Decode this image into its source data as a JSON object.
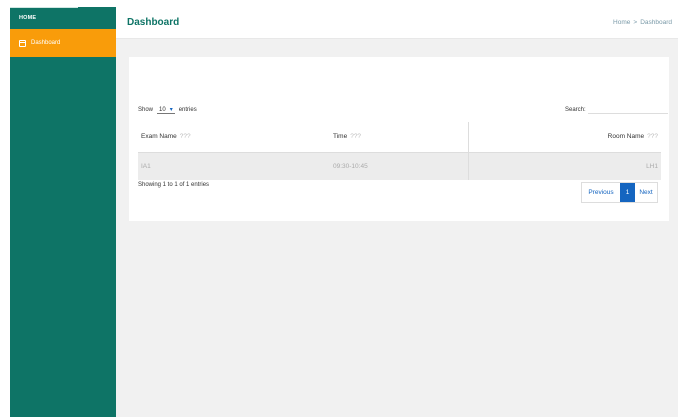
{
  "sidebar": {
    "brand": "HOME",
    "items": [
      {
        "label": "Dashboard",
        "icon": "calendar-icon"
      }
    ]
  },
  "header": {
    "title": "Dashboard",
    "breadcrumb": [
      "Home",
      ">",
      "Dashboard"
    ]
  },
  "table_controls": {
    "show_label": "Show",
    "page_size": "10",
    "entries_label": "entries",
    "search_label": "Search:",
    "search_value": ""
  },
  "table": {
    "columns": [
      {
        "label": "Exam Name",
        "sort": "???"
      },
      {
        "label": "Time",
        "sort": "???"
      },
      {
        "label": "Room Name",
        "sort": "???"
      }
    ],
    "rows": [
      {
        "exam": "IA1",
        "time": "09:30-10:45",
        "room": "LH1"
      }
    ]
  },
  "footer": {
    "info": "Showing 1 to 1 of 1 entries",
    "previous": "Previous",
    "current_page": "1",
    "next": "Next"
  },
  "colors": {
    "sidebar": "#0e7466",
    "active_nav": "#f99c0a",
    "accent": "#1565c0"
  }
}
